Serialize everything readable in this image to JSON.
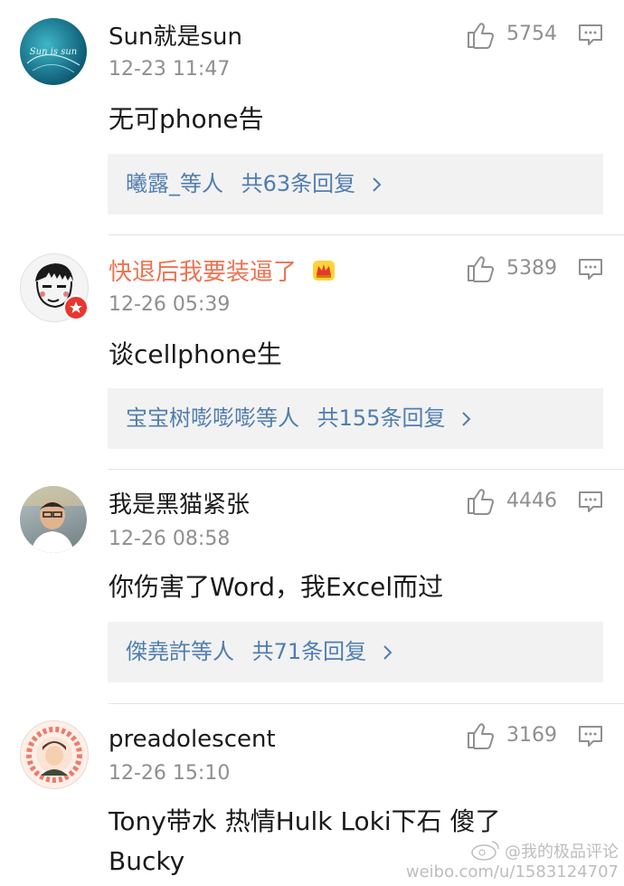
{
  "comments": [
    {
      "username": "Sun就是sun",
      "vip": false,
      "time": "12-23 11:47",
      "likes": "5754",
      "text": "无可phone告",
      "reply": {
        "names": "曦露_等人",
        "count_text": "共63条回复"
      },
      "avatar_text": "Sun is sun"
    },
    {
      "username": "快退后我要装逼了",
      "vip": true,
      "time": "12-26 05:39",
      "likes": "5389",
      "text": "谈cellphone生",
      "reply": {
        "names": "宝宝树嘭嘭嘭等人",
        "count_text": "共155条回复"
      }
    },
    {
      "username": "我是黑猫紧张",
      "vip": false,
      "time": "12-26 08:58",
      "likes": "4446",
      "text": "你伤害了Word，我Excel而过",
      "reply": {
        "names": "傑堯許等人",
        "count_text": "共71条回复"
      }
    },
    {
      "username": "preadolescent",
      "vip": false,
      "time": "12-26 15:10",
      "likes": "3169",
      "text": "Tony带水 热情Hulk Loki下石 傻了 Bucky"
    }
  ],
  "watermark": {
    "top": "@我的极品评论",
    "bottom": "weibo.com/u/1583124707"
  },
  "icons": {
    "like": "thumbs-up-icon",
    "reply": "comment-icon",
    "crown": "crown-icon",
    "chevron": "chevron-right-icon"
  },
  "colors": {
    "link": "#507daf",
    "vip_name": "#eb7350",
    "meta": "#8f8f8f",
    "reply_bg": "#f2f2f2"
  }
}
